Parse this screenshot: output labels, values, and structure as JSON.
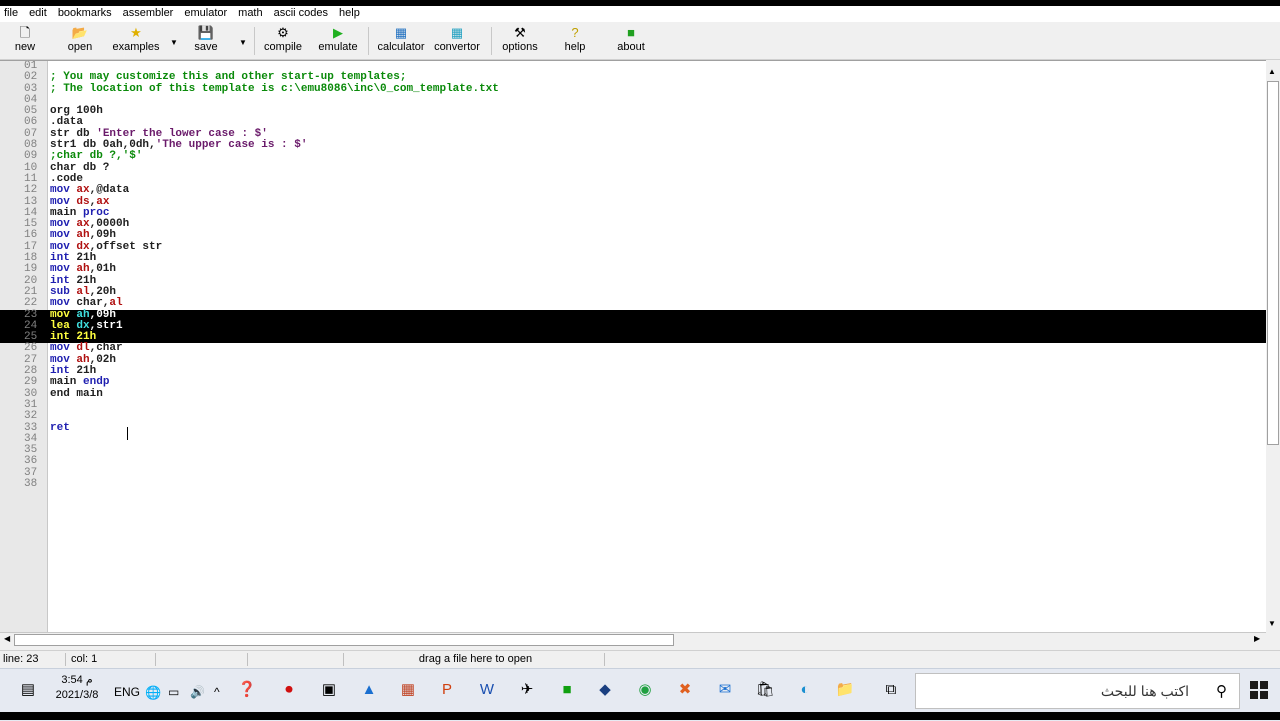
{
  "menu": [
    "file",
    "edit",
    "bookmarks",
    "assembler",
    "emulator",
    "math",
    "ascii codes",
    "help"
  ],
  "toolbar": {
    "new": "new",
    "open": "open",
    "examples": "examples",
    "save": "save",
    "compile": "compile",
    "emulate": "emulate",
    "calculator": "calculator",
    "convertor": "convertor",
    "options": "options",
    "help": "help",
    "about": "about"
  },
  "editor": {
    "selected_lines": [
      23,
      24,
      25
    ],
    "lines": [
      {
        "n": "01",
        "t": []
      },
      {
        "n": "02",
        "t": [
          [
            "cm",
            "; You may customize this and other start-up templates;"
          ]
        ]
      },
      {
        "n": "03",
        "t": [
          [
            "cm",
            "; The location of this template is c:\\emu8086\\inc\\0_com_template.txt"
          ]
        ]
      },
      {
        "n": "04",
        "t": []
      },
      {
        "n": "05",
        "t": [
          [
            "plain",
            "org 100h"
          ]
        ]
      },
      {
        "n": "06",
        "t": [
          [
            "plain",
            ".data"
          ]
        ]
      },
      {
        "n": "07",
        "t": [
          [
            "plain",
            "str db "
          ],
          [
            "str",
            "'Enter the lower case : $'"
          ]
        ]
      },
      {
        "n": "08",
        "t": [
          [
            "plain",
            "str1 db 0ah,0dh,"
          ],
          [
            "str",
            "'The upper case is : $'"
          ]
        ]
      },
      {
        "n": "09",
        "t": [
          [
            "cm",
            ";char db ?,'$'"
          ]
        ]
      },
      {
        "n": "10",
        "t": [
          [
            "plain",
            "char db ?"
          ]
        ]
      },
      {
        "n": "11",
        "t": [
          [
            "plain",
            ".code"
          ]
        ]
      },
      {
        "n": "12",
        "t": [
          [
            "kw",
            "mov "
          ],
          [
            "reg",
            "ax"
          ],
          [
            "plain",
            ",@data"
          ]
        ]
      },
      {
        "n": "13",
        "t": [
          [
            "kw",
            "mov "
          ],
          [
            "reg",
            "ds"
          ],
          [
            "plain",
            ","
          ],
          [
            "reg",
            "ax"
          ]
        ]
      },
      {
        "n": "14",
        "t": [
          [
            "plain",
            "main "
          ],
          [
            "kw",
            "proc"
          ]
        ]
      },
      {
        "n": "15",
        "t": [
          [
            "kw",
            "mov "
          ],
          [
            "reg",
            "ax"
          ],
          [
            "plain",
            ",0000h"
          ]
        ]
      },
      {
        "n": "16",
        "t": [
          [
            "kw",
            "mov "
          ],
          [
            "reg",
            "ah"
          ],
          [
            "plain",
            ",09h"
          ]
        ]
      },
      {
        "n": "17",
        "t": [
          [
            "kw",
            "mov "
          ],
          [
            "reg",
            "dx"
          ],
          [
            "plain",
            ",offset str"
          ]
        ]
      },
      {
        "n": "18",
        "t": [
          [
            "kw",
            "int "
          ],
          [
            "plain",
            "21h"
          ]
        ]
      },
      {
        "n": "19",
        "t": [
          [
            "kw",
            "mov "
          ],
          [
            "reg",
            "ah"
          ],
          [
            "plain",
            ",01h"
          ]
        ]
      },
      {
        "n": "20",
        "t": [
          [
            "kw",
            "int "
          ],
          [
            "plain",
            "21h"
          ]
        ]
      },
      {
        "n": "21",
        "t": [
          [
            "kw",
            "sub "
          ],
          [
            "reg",
            "al"
          ],
          [
            "plain",
            ",20h"
          ]
        ]
      },
      {
        "n": "22",
        "t": [
          [
            "kw",
            "mov "
          ],
          [
            "plain",
            "char,"
          ],
          [
            "reg",
            "al"
          ]
        ]
      },
      {
        "n": "23",
        "t": [
          [
            "kw",
            "mov "
          ],
          [
            "reg",
            "ah"
          ],
          [
            "plain2",
            ",09h"
          ]
        ]
      },
      {
        "n": "24",
        "t": [
          [
            "kw",
            "lea "
          ],
          [
            "reg",
            "dx"
          ],
          [
            "plain2",
            ",str1"
          ]
        ]
      },
      {
        "n": "25",
        "t": [
          [
            "kw",
            "int "
          ],
          [
            "plain",
            "21h"
          ]
        ]
      },
      {
        "n": "26",
        "t": [
          [
            "kw",
            "mov "
          ],
          [
            "reg",
            "dl"
          ],
          [
            "plain",
            ",char"
          ]
        ]
      },
      {
        "n": "27",
        "t": [
          [
            "kw",
            "mov "
          ],
          [
            "reg",
            "ah"
          ],
          [
            "plain",
            ",02h"
          ]
        ]
      },
      {
        "n": "28",
        "t": [
          [
            "kw",
            "int "
          ],
          [
            "plain",
            "21h"
          ]
        ]
      },
      {
        "n": "29",
        "t": [
          [
            "plain",
            "main "
          ],
          [
            "kw",
            "endp"
          ]
        ]
      },
      {
        "n": "30",
        "t": [
          [
            "plain",
            "end main"
          ]
        ]
      },
      {
        "n": "31",
        "t": []
      },
      {
        "n": "32",
        "t": []
      },
      {
        "n": "33",
        "t": [
          [
            "kw",
            "ret"
          ]
        ]
      },
      {
        "n": "34",
        "t": []
      },
      {
        "n": "35",
        "t": []
      },
      {
        "n": "36",
        "t": []
      },
      {
        "n": "37",
        "t": []
      },
      {
        "n": "38",
        "t": []
      }
    ]
  },
  "status": {
    "line": "line: 23",
    "col": "col: 1",
    "hint": "drag a file here to open"
  },
  "taskbar": {
    "time": "3:54 م",
    "date": "2021/3/8",
    "lang": "ENG",
    "search_placeholder": "اكتب هنا للبحث"
  }
}
